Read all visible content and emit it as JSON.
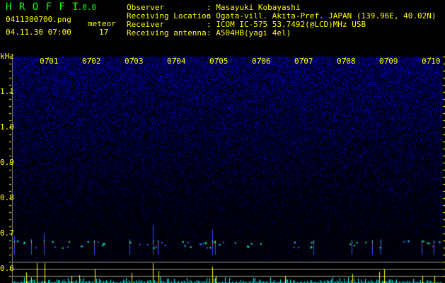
{
  "app": {
    "title": "H R O F F T",
    "version": "1.0.0"
  },
  "file": {
    "name": "0411300700.png",
    "datetime": "04.11.30 07:00"
  },
  "meteor": {
    "label": "meteor",
    "count": "17"
  },
  "info": [
    {
      "label": "Observer",
      "value": ": Masayuki Kobayashi"
    },
    {
      "label": "Receiving Location",
      "value": ": Ogata-vill. Akita-Pref. JAPAN (139.96E, 40.02N)"
    },
    {
      "label": "Receiver",
      "value": ": ICOM IC-575 53.7492(@LCD)MHz USB"
    },
    {
      "label": "Receiving antenna",
      "value": ": A504HB(yagi 4el)"
    }
  ],
  "axis": {
    "unit": "kHz",
    "freq_labels": [
      "1.1",
      "1.0",
      "0.9",
      "0.8",
      "0.7",
      "0.6"
    ],
    "time_labels": [
      "0701",
      "0702",
      "0703",
      "0704",
      "0705",
      "0706",
      "0707",
      "0708",
      "0709",
      "0710"
    ]
  },
  "colors": {
    "text": "#ffff00",
    "title": "#00ff00",
    "noise": "#2020c0",
    "bars_low": "#00ffff",
    "bars_high": "#ffff00"
  }
}
